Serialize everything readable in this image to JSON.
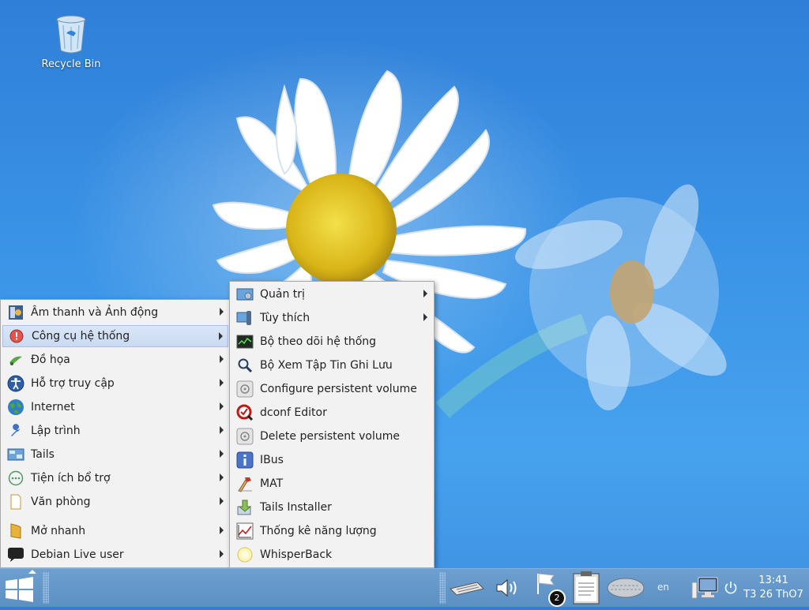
{
  "desktop": {
    "icons": [
      {
        "label": "Recycle Bin",
        "icon": "recycle-bin-icon"
      }
    ]
  },
  "main_menu": {
    "items": [
      {
        "label": "Âm thanh và Ảnh động",
        "icon": "multimedia-icon",
        "submenu": true
      },
      {
        "label": "Công cụ hệ thống",
        "icon": "system-tools-icon",
        "submenu": true,
        "active": true
      },
      {
        "label": "Đồ họa",
        "icon": "graphics-icon",
        "submenu": true
      },
      {
        "label": "Hỗ trợ truy cập",
        "icon": "accessibility-icon",
        "submenu": true
      },
      {
        "label": "Internet",
        "icon": "globe-icon",
        "submenu": true
      },
      {
        "label": "Lập trình",
        "icon": "wrench-icon",
        "submenu": true
      },
      {
        "label": "Tails",
        "icon": "tails-icon",
        "submenu": true
      },
      {
        "label": "Tiện ích bổ trợ",
        "icon": "accessories-icon",
        "submenu": true
      },
      {
        "label": "Văn phòng",
        "icon": "office-icon",
        "submenu": true
      },
      {
        "label": "Mở nhanh",
        "icon": "folder-icon",
        "submenu": true
      },
      {
        "label": "Debian Live user",
        "icon": "user-bubble-icon",
        "submenu": true
      }
    ]
  },
  "sub_menu": {
    "items": [
      {
        "label": "Quản trị",
        "icon": "administration-icon",
        "submenu": true
      },
      {
        "label": "Tùy thích",
        "icon": "preferences-icon",
        "submenu": true
      },
      {
        "label": "Bộ theo dõi hệ thống",
        "icon": "system-monitor-icon"
      },
      {
        "label": "Bộ Xem Tập Tin Ghi Lưu",
        "icon": "log-viewer-icon"
      },
      {
        "label": "Configure persistent volume",
        "icon": "persistence-icon"
      },
      {
        "label": "dconf Editor",
        "icon": "dconf-icon"
      },
      {
        "label": "Delete persistent volume",
        "icon": "persistence-delete-icon"
      },
      {
        "label": "IBus",
        "icon": "ibus-icon"
      },
      {
        "label": "MAT",
        "icon": "mat-icon"
      },
      {
        "label": "Tails Installer",
        "icon": "installer-icon"
      },
      {
        "label": "Thống kê năng lượng",
        "icon": "power-stats-icon"
      },
      {
        "label": "WhisperBack",
        "icon": "whisperback-icon"
      }
    ]
  },
  "taskbar": {
    "start_icon": "windows-start-icon",
    "tray": {
      "keyboard": "keyboard-icon",
      "volume": "volume-icon",
      "notifications_count": "2",
      "clipboard": "clipboard-icon",
      "onboard": "onboard-keyboard-icon",
      "language": "en",
      "network": "network-icon",
      "power": "power-icon"
    },
    "clock": {
      "time": "13:41",
      "date": "T3 26 ThO7"
    }
  },
  "colors": {
    "accent": "#c9daf2",
    "taskbar": "#5c8fc3",
    "menu_bg": "#f2f2f2"
  }
}
